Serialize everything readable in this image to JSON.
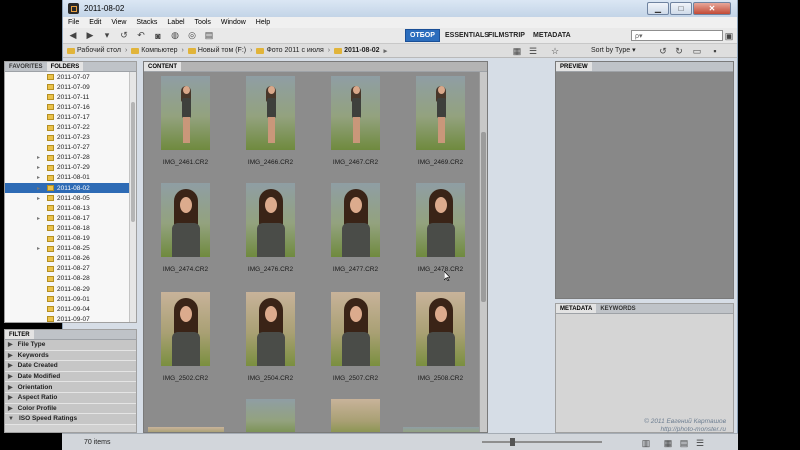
{
  "window": {
    "title": "2011-08-02"
  },
  "menu": [
    "File",
    "Edit",
    "View",
    "Stacks",
    "Label",
    "Tools",
    "Window",
    "Help"
  ],
  "workspaces": [
    "ОТБОР",
    "ESSENTIALS",
    "FILMSTRIP",
    "METADATA"
  ],
  "search": {
    "placeholder": "ρ▾"
  },
  "path": [
    "Рабочий стол",
    "Компьютер",
    "Новый том (F:)",
    "Фото 2011 с июля",
    "2011-08-02"
  ],
  "sort_label": "Sort by Type ▾",
  "left_tabs": [
    "FAVORITES",
    "FOLDERS"
  ],
  "folders": [
    {
      "name": "2011-07-07",
      "exp": false
    },
    {
      "name": "2011-07-09",
      "exp": false
    },
    {
      "name": "2011-07-11",
      "exp": false
    },
    {
      "name": "2011-07-16",
      "exp": false
    },
    {
      "name": "2011-07-17",
      "exp": false
    },
    {
      "name": "2011-07-22",
      "exp": false
    },
    {
      "name": "2011-07-23",
      "exp": false
    },
    {
      "name": "2011-07-27",
      "exp": false
    },
    {
      "name": "2011-07-28",
      "exp": true
    },
    {
      "name": "2011-07-29",
      "exp": true
    },
    {
      "name": "2011-08-01",
      "exp": true
    },
    {
      "name": "2011-08-02",
      "exp": true,
      "selected": true
    },
    {
      "name": "2011-08-05",
      "exp": true
    },
    {
      "name": "2011-08-13",
      "exp": false
    },
    {
      "name": "2011-08-17",
      "exp": true
    },
    {
      "name": "2011-08-18",
      "exp": false
    },
    {
      "name": "2011-08-19",
      "exp": false
    },
    {
      "name": "2011-08-25",
      "exp": true
    },
    {
      "name": "2011-08-26",
      "exp": false
    },
    {
      "name": "2011-08-27",
      "exp": false
    },
    {
      "name": "2011-08-28",
      "exp": false
    },
    {
      "name": "2011-08-29",
      "exp": false
    },
    {
      "name": "2011-09-01",
      "exp": false
    },
    {
      "name": "2011-09-04",
      "exp": false
    },
    {
      "name": "2011-09-07",
      "exp": false
    }
  ],
  "filter_tab": "FILTER",
  "filters": [
    {
      "name": "File Type",
      "open": false
    },
    {
      "name": "Keywords",
      "open": false
    },
    {
      "name": "Date Created",
      "open": false
    },
    {
      "name": "Date Modified",
      "open": false
    },
    {
      "name": "Orientation",
      "open": false
    },
    {
      "name": "Aspect Ratio",
      "open": false
    },
    {
      "name": "Color Profile",
      "open": false
    },
    {
      "name": "ISO Speed Ratings",
      "open": true
    }
  ],
  "content_tab": "CONTENT",
  "thumbnails": [
    {
      "name": "IMG_2461.CR2",
      "kind": "full"
    },
    {
      "name": "IMG_2466.CR2",
      "kind": "full"
    },
    {
      "name": "IMG_2467.CR2",
      "kind": "full"
    },
    {
      "name": "IMG_2469.CR2",
      "kind": "full"
    },
    {
      "name": "IMG_2474.CR2",
      "kind": "bust"
    },
    {
      "name": "IMG_2476.CR2",
      "kind": "bust"
    },
    {
      "name": "IMG_2477.CR2",
      "kind": "bust"
    },
    {
      "name": "IMG_2478.CR2",
      "kind": "bust"
    },
    {
      "name": "IMG_2502.CR2",
      "kind": "bust"
    },
    {
      "name": "IMG_2504.CR2",
      "kind": "bust"
    },
    {
      "name": "IMG_2507.CR2",
      "kind": "bust"
    },
    {
      "name": "IMG_2508.CR2",
      "kind": "bust"
    }
  ],
  "preview_tab": "PREVIEW",
  "meta_tabs": [
    "METADATA",
    "KEYWORDS"
  ],
  "status": {
    "items": "70 items"
  },
  "watermark": [
    "© 2011 Евгений Карташов",
    "http://photo-monster.ru"
  ]
}
